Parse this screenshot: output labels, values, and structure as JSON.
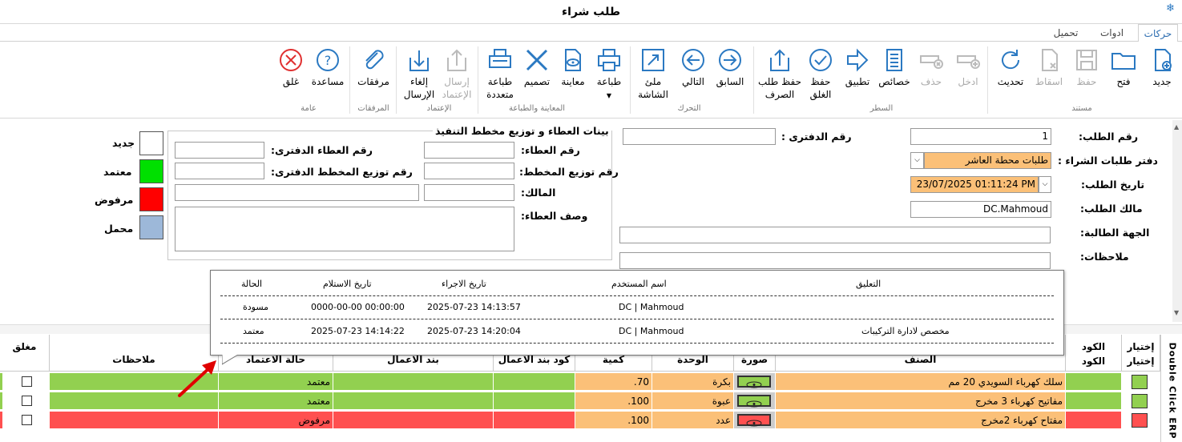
{
  "window": {
    "title": "طلب شراء"
  },
  "tabs": [
    {
      "label": "حركات"
    },
    {
      "label": "ادوات"
    },
    {
      "label": "تحميل"
    }
  ],
  "ribbon": {
    "buttons": {
      "new": "جديد",
      "open": "فتح",
      "save": "حفظ",
      "drop": "اسقاط",
      "refresh": "تحديث",
      "insert": "ادخل",
      "delete": "حذف",
      "props": "خصائص",
      "apply": "تطبيق",
      "save_close_1": "حفظ",
      "save_close_2": "الغلق",
      "save_exchange_1": "حفظ طلب",
      "save_exchange_2": "الصرف",
      "prev": "السابق",
      "next": "التالي",
      "fill_1": "ملئ",
      "fill_2": "الشاشة",
      "print": "طباعة",
      "preview": "معاينة",
      "design": "تصميم",
      "multi_1": "طباعة",
      "multi_2": "متعددة",
      "send_approve_1": "إرسال",
      "send_approve_2": "الإعتماد",
      "cancel_send_1": "إلغاء",
      "cancel_send_2": "الإرسال",
      "attachments": "مرفقات",
      "help": "مساعدة",
      "close": "غلق"
    },
    "groups": {
      "document": "مستند",
      "row": "السطر",
      "move": "التحرك",
      "preview_print": "المعاينة والطباعة",
      "approval": "الإعتماد",
      "attachments": "المرفقات",
      "general": "عامة"
    }
  },
  "form": {
    "req_no_label": "رقم الطلب:",
    "req_no": "1",
    "book_label": "دفتر طلبات الشراء :",
    "book": "طلبات محطة العاشر",
    "date_label": "تاريخ الطلب:",
    "date": "23/07/2025 01:11:24 PM",
    "owner_label": "مالك الطلب:",
    "owner": "DC.Mahmoud",
    "dept_label": "الجهة الطالبة:",
    "notes_label": "ملاحظات:",
    "ledger_label": "رقم الدفترى :"
  },
  "tender": {
    "title": "بينات العطاء و توزيع مخطط التنفيذ",
    "tender_no": "رقم العطاء:",
    "plan_no": "رقم توزيع المخطط:",
    "owner": "المالك:",
    "desc": "وصف العطاء:",
    "tender_ledger": "رقم العطاء الدفترى:",
    "plan_ledger": "رقم توزيع المخطط الدفترى:"
  },
  "legend": [
    {
      "label": "جديد",
      "color": "#ffffff"
    },
    {
      "label": "معتمد",
      "color": "#00e000"
    },
    {
      "label": "مرفوض",
      "color": "#ff0000"
    },
    {
      "label": "محمل",
      "color": "#9db8d9"
    }
  ],
  "grid": {
    "headers": {
      "select_1": "إختيار",
      "select_2": "إختيار",
      "code_1": "الكود",
      "code_2": "الكود",
      "item": "الصنف",
      "image": "صورة",
      "unit": "الوحدة",
      "qty": "كمية",
      "work_code": "كود بند الاعمال",
      "work_item": "بند الاعمال",
      "approval_status": "حالة الاعتماد",
      "notes": "ملاحظات",
      "closed": "مغلق"
    },
    "rows": [
      {
        "item": "سلك كهرباء السويدي 20 مم",
        "unit": "بكرة",
        "qty": "70.",
        "status": "معتمد",
        "color": "#92d050"
      },
      {
        "item": "مفاتيح كهرباء 3 مخرج",
        "unit": "عبوة",
        "qty": "100.",
        "status": "معتمد",
        "color": "#92d050"
      },
      {
        "item": "مفتاح كهرباء 2مخرج",
        "unit": "عدد",
        "qty": "100.",
        "status": "مرفوض",
        "color": "#ff5050"
      }
    ]
  },
  "popup": {
    "headers": {
      "comment": "التعليق",
      "user": "اسم المستخدم",
      "action_date": "تاريخ الاجراء",
      "receive_date": "تاريخ الاستلام",
      "status": "الحالة"
    },
    "rows": [
      {
        "comment": "",
        "user": "DC | Mahmoud",
        "action_date": "2025-07-23 14:13:57",
        "receive_date": "0000-00-00 00:00:00",
        "status": "مسودة"
      },
      {
        "comment": "مخصص لادارة التركيبات",
        "user": "DC | Mahmoud",
        "action_date": "2025-07-23 14:20:04",
        "receive_date": "2025-07-23 14:14:22",
        "status": "معتمد"
      }
    ]
  },
  "sidebar": {
    "text": "Double Click ERP"
  },
  "colors": {
    "accent": "#2b79c2",
    "orange": "#fbc078",
    "approved": "#92d050",
    "rejected": "#ff5050",
    "annotation": "#e00000"
  }
}
